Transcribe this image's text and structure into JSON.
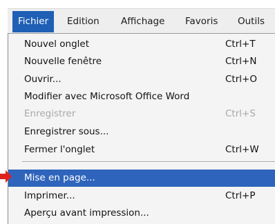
{
  "menubar": {
    "items": [
      {
        "label": "Fichier",
        "active": true
      },
      {
        "label": "Edition"
      },
      {
        "label": "Affichage"
      },
      {
        "label": "Favoris"
      },
      {
        "label": "Outils"
      }
    ]
  },
  "menu": {
    "items": [
      {
        "label": "Nouvel onglet",
        "shortcut": "Ctrl+T"
      },
      {
        "label": "Nouvelle fenêtre",
        "shortcut": "Ctrl+N"
      },
      {
        "label": "Ouvrir...",
        "shortcut": "Ctrl+O"
      },
      {
        "label": "Modifier avec Microsoft Office Word",
        "shortcut": ""
      },
      {
        "label": "Enregistrer",
        "shortcut": "Ctrl+S",
        "disabled": true
      },
      {
        "label": "Enregistrer sous...",
        "shortcut": ""
      },
      {
        "label": "Fermer l'onglet",
        "shortcut": "Ctrl+W"
      },
      {
        "label": "Mise en page...",
        "shortcut": "",
        "highlighted": true
      },
      {
        "label": "Imprimer...",
        "shortcut": "Ctrl+P"
      },
      {
        "label": "Aperçu avant impression...",
        "shortcut": ""
      }
    ]
  },
  "colors": {
    "active_menu": "#1f5fb5",
    "highlight": "#2e64bb",
    "arrow": "#e0201b",
    "disabled_text": "#a8a8a8"
  },
  "icons": {
    "pointer_arrow": "red-arrow-icon"
  }
}
